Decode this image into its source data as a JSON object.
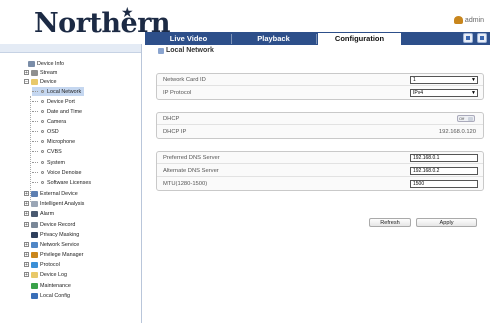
{
  "header": {
    "logo": "Northern",
    "logo_mark": "★",
    "user": "admin",
    "tabs": [
      {
        "label": "Live Video",
        "active": false
      },
      {
        "label": "Playback",
        "active": false
      },
      {
        "label": "Configuration",
        "active": true
      }
    ]
  },
  "sidebar": {
    "items": [
      {
        "label": "Device Info",
        "icon": "monitor-icon"
      },
      {
        "label": "Stream",
        "icon": "stream-icon"
      },
      {
        "label": "Device",
        "icon": "folder-icon"
      },
      {
        "label": "Local Network",
        "icon": "circle-icon",
        "selected": true
      },
      {
        "label": "Device Port",
        "icon": "circle-icon"
      },
      {
        "label": "Date and Time",
        "icon": "circle-icon"
      },
      {
        "label": "Camera",
        "icon": "circle-icon"
      },
      {
        "label": "OSD",
        "icon": "circle-icon"
      },
      {
        "label": "Microphone",
        "icon": "circle-icon"
      },
      {
        "label": "CVBS",
        "icon": "circle-icon"
      },
      {
        "label": "System",
        "icon": "circle-icon"
      },
      {
        "label": "Voice Denoise",
        "icon": "circle-icon"
      },
      {
        "label": "Software Licenses",
        "icon": "circle-icon"
      },
      {
        "label": "External Device",
        "icon": "plug-icon"
      },
      {
        "label": "Intelligent Analysis",
        "icon": "analysis-icon"
      },
      {
        "label": "Alarm",
        "icon": "alarm-icon"
      },
      {
        "label": "Device Record",
        "icon": "record-icon"
      },
      {
        "label": "Privacy Masking",
        "icon": "mask-icon"
      },
      {
        "label": "Network Service",
        "icon": "network-icon"
      },
      {
        "label": "Privilege Manager",
        "icon": "user-icon"
      },
      {
        "label": "Protocol",
        "icon": "protocol-icon"
      },
      {
        "label": "Device Log",
        "icon": "log-icon"
      },
      {
        "label": "Maintenance",
        "icon": "maintenance-icon"
      },
      {
        "label": "Local Config",
        "icon": "config-icon"
      }
    ]
  },
  "main": {
    "title": "Local Network",
    "network_card_label": "Network Card ID",
    "network_card_value": "1",
    "ip_protocol_label": "IP Protocol",
    "ip_protocol_value": "IPv4",
    "dhcp_label": "DHCP",
    "dhcp_state": "Off",
    "dhcp_ip_label": "DHCP IP",
    "dhcp_ip_value": "192.168.0.120",
    "dns_preferred_label": "Preferred DNS Server",
    "dns_preferred_value": "192.168.0.1",
    "dns_alternate_label": "Alternate DNS Server",
    "dns_alternate_value": "192.168.0.2",
    "mtu_label": "MTU(1280-1500)",
    "mtu_value": "1500",
    "refresh_label": "Refresh",
    "apply_label": "Apply"
  },
  "colors": {
    "tab_bar": "#2d4f8a",
    "logo": "#1c2a44",
    "selection": "#c5d7f0"
  }
}
